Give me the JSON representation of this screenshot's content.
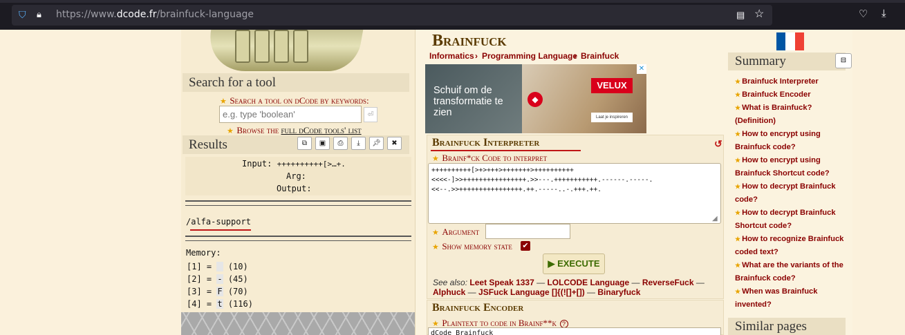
{
  "browser": {
    "url_prefix": "https://www.",
    "url_host": "dcode.fr",
    "url_path": "/brainfuck-language"
  },
  "left": {
    "search_title": "Search for a tool",
    "search_label": "Search a tool on dCode by keywords:",
    "search_placeholder": "e.g. type 'boolean'",
    "browse_prefix": "Browse the ",
    "browse_link": "full dCode tools' list",
    "results_title": "Results",
    "result_input_label": "Input:",
    "result_input_value": "++++++++++[>…+.",
    "result_arg_label": "Arg:",
    "result_output_label": "Output:",
    "result_output": "/alfa-support",
    "memory_title": "Memory:",
    "memory": [
      {
        "idx": "[1] =",
        "char": " ",
        "val": "(10)"
      },
      {
        "idx": "[2] =",
        "char": "-",
        "val": "(45)"
      },
      {
        "idx": "[3] =",
        "char": "F",
        "val": "(70)"
      },
      {
        "idx": "[4] =",
        "char": "t",
        "val": "(116)"
      }
    ]
  },
  "main": {
    "title": "Brainfuck",
    "breadcrumb": [
      "Informatics",
      "Programming Language",
      "Brainfuck"
    ],
    "breadcrumb_sep": "›",
    "ad": {
      "text": "Schuif om de transformatie te zien",
      "brand": "VELUX",
      "cta": "Laat je inspireren"
    },
    "interpreter": {
      "title": "Brainfuck Interpreter",
      "code_label": "Brainf*ck Code to interpret",
      "code": "++++++++++[>+>+++>+++++++>++++++++++\n<<<<-]>>++++++++++++++++.>>---.+++++++++++.------.-----.\n<<--.>>++++++++++++++++.++.-----..-.+++.++.",
      "argument_label": "Argument",
      "memory_label": "Show memory state",
      "execute_label": "▶ EXECUTE",
      "seealso_prefix": "See also:",
      "seealso_links": [
        "Leet Speak 1337",
        "LOLCODE Language",
        "ReverseFuck",
        "Alphuck",
        "JSFuck Language []{(![]+[])",
        "Binaryfuck"
      ],
      "seealso_sep": " — "
    },
    "encoder": {
      "title": "Brainfuck Encoder",
      "plaintext_label": "Plaintext to code in Brainf**k",
      "plaintext_value": "dCode Brainfuck"
    }
  },
  "right": {
    "summary_title": "Summary",
    "summary_items": [
      "Brainfuck Interpreter",
      "Brainfuck Encoder",
      "What is Brainfuck? (Definition)",
      "How to encrypt using Brainfuck code?",
      "How to encrypt using Brainfuck Shortcut code?",
      "How to decrypt Brainfuck code?",
      "How to decrypt Brainfuck Shortcut code?",
      "How to recognize Brainfuck coded text?",
      "What are the variants of the Brainfuck code?",
      "When was Brainfuck invented?"
    ],
    "similar_title": "Similar pages"
  },
  "colors": {
    "accent_red": "#8a0000",
    "title_brown": "#5a3a00",
    "panel_bg": "#f6ecd4"
  }
}
